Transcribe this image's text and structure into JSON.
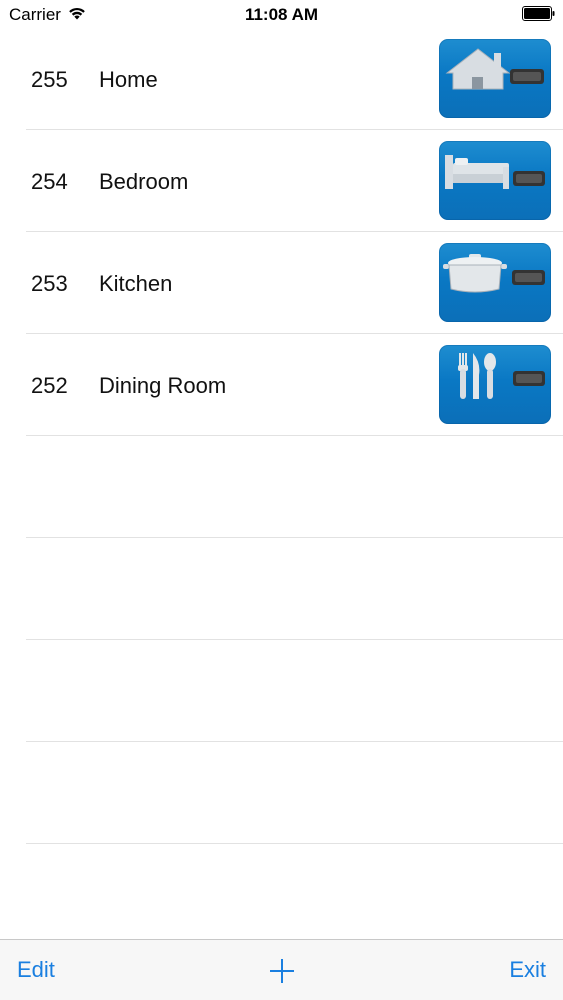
{
  "status_bar": {
    "carrier": "Carrier",
    "time": "11:08 AM",
    "icons": [
      "wifi-icon",
      "battery-icon"
    ]
  },
  "rooms": [
    {
      "number": "255",
      "name": "Home",
      "icon": "house-icon"
    },
    {
      "number": "254",
      "name": "Bedroom",
      "icon": "bed-icon"
    },
    {
      "number": "253",
      "name": "Kitchen",
      "icon": "pot-icon"
    },
    {
      "number": "252",
      "name": "Dining Room",
      "icon": "utensils-icon"
    }
  ],
  "toolbar": {
    "edit_label": "Edit",
    "add_icon": "plus-icon",
    "exit_label": "Exit"
  },
  "colors": {
    "accent": "#1a7fe0",
    "icon_tile": "#0a78c4"
  }
}
